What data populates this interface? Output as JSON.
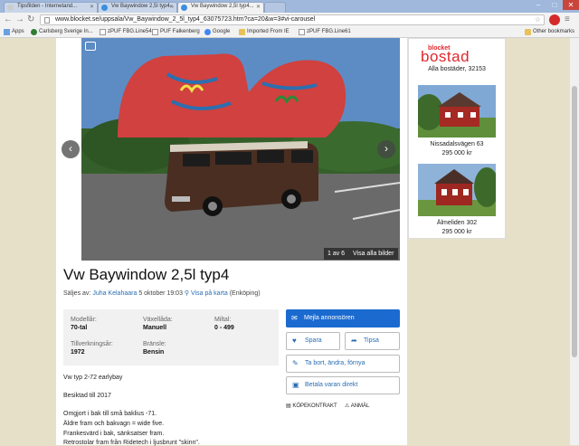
{
  "browser": {
    "tabs": [
      {
        "label": "Tipsfilden - Internetand..."
      },
      {
        "label": "Vw Baywindow 2,5l typ4..."
      },
      {
        "label": "Vw Baywindow 2,5l typ4..."
      }
    ],
    "url": "www.blocket.se/uppsala/Vw_Baywindow_2_5l_typ4_63075723.htm?ca=20&w=3#vi-carousel",
    "bookmarks": [
      "Apps",
      "Carlsberg Sverige In...",
      "zPUF FBG.Line54",
      "PUF Falkenberg",
      "Google",
      "Imported From IE",
      "zPUF FBG.Line61"
    ],
    "other_bookmarks": "Other bookmarks"
  },
  "gallery": {
    "counter": "1 av 6",
    "view_all": "Visa alla bilder"
  },
  "listing": {
    "title": "Vw Baywindow 2,5l typ4",
    "sold_by_prefix": "Säljes av:",
    "seller": "Juha Kelahaara",
    "date": "5 oktober 19:03",
    "map_link": "Visa på karta",
    "location": "(Enköping)"
  },
  "specs": [
    {
      "label": "Modellår:",
      "value": "70-tal"
    },
    {
      "label": "Växellåda:",
      "value": "Manuell"
    },
    {
      "label": "Miltal:",
      "value": "0 - 499"
    },
    {
      "label": "Tillverkningsår:",
      "value": "1972"
    },
    {
      "label": "Bränsle:",
      "value": "Bensin"
    }
  ],
  "description": [
    "Vw typ 2-72 earlybay",
    "Besiktad till 2017",
    "Omgjort i bak till små baklius -71.",
    "Äldre fram och bakvagn = wide five.",
    "Frankesvärd i bak, sänksatser fram.",
    "Retrostolar fram från Ridetech i ljusbrunt \"skinn\"."
  ],
  "actions": {
    "mail": "Mejla annonsören",
    "save": "Spara",
    "tip": "Tipsa",
    "edit": "Ta bort, ändra, förnya",
    "pay": "Betala varan direkt",
    "contract": "KÖPEKONTRAKT",
    "report": "ANMÄL"
  },
  "sidebar": {
    "logo_top": "blocket",
    "logo_main": "bostad",
    "tagline": "Alla bostäder, 32153",
    "listings": [
      {
        "title": "Nissadalsvägen 63",
        "price": "295 000 kr"
      },
      {
        "title": "Älmeliden 302",
        "price": "295 000 kr"
      }
    ]
  },
  "colors": {
    "accent": "#1a6ad0",
    "link": "#2a6db4",
    "brand": "#e0282c"
  }
}
